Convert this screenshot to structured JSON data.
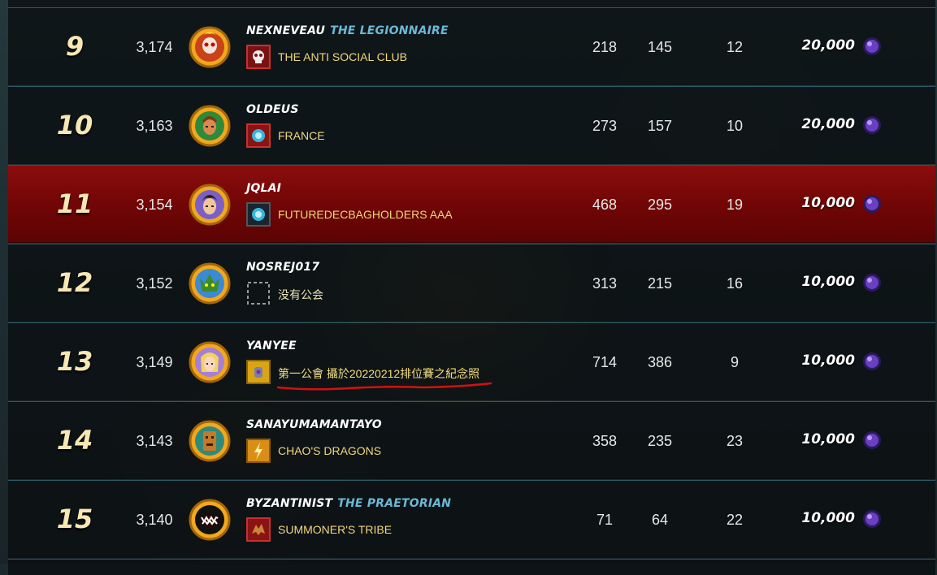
{
  "leaderboard": {
    "rows": [
      {
        "rank": "9",
        "rating": "3,174",
        "player": "NEXNEVEAU",
        "title": "THE LEGIONNAIRE",
        "guild": "THE ANTI SOCIAL CLUB",
        "stat1": "218",
        "stat2": "145",
        "stat3": "12",
        "reward": "20,000",
        "avatar_icon": "skull-flame-avatar-icon",
        "guild_icon": "skull-banner-icon"
      },
      {
        "rank": "10",
        "rating": "3,163",
        "player": "OLDEUS",
        "title": "",
        "guild": "FRANCE",
        "stat1": "273",
        "stat2": "157",
        "stat3": "10",
        "reward": "20,000",
        "avatar_icon": "warrior-avatar-icon",
        "guild_icon": "orb-banner-icon"
      },
      {
        "rank": "11",
        "rating": "3,154",
        "player": "JQLAI",
        "title": "",
        "guild": "FUTUREDECBAGHOLDERS AAA",
        "stat1": "468",
        "stat2": "295",
        "stat3": "19",
        "reward": "10,000",
        "avatar_icon": "hero-avatar-icon",
        "guild_icon": "orb-banner-icon"
      },
      {
        "rank": "12",
        "rating": "3,152",
        "player": "NOSREJ017",
        "title": "",
        "guild": "没有公会",
        "stat1": "313",
        "stat2": "215",
        "stat3": "16",
        "reward": "10,000",
        "avatar_icon": "goblin-avatar-icon",
        "guild_icon": "empty-guild-icon"
      },
      {
        "rank": "13",
        "rating": "3,149",
        "player": "YANYEE",
        "title": "",
        "guild": "第一公會 攝於20220212排位賽之紀念照",
        "stat1": "714",
        "stat2": "386",
        "stat3": "9",
        "reward": "10,000",
        "avatar_icon": "princess-avatar-icon",
        "guild_icon": "gauntlet-banner-icon"
      },
      {
        "rank": "14",
        "rating": "3,143",
        "player": "SANAYUMAMANTAYO",
        "title": "",
        "guild": "CHAO'S DRAGONS",
        "stat1": "358",
        "stat2": "235",
        "stat3": "23",
        "reward": "10,000",
        "avatar_icon": "totem-avatar-icon",
        "guild_icon": "lightning-banner-icon"
      },
      {
        "rank": "15",
        "rating": "3,140",
        "player": "BYZANTINIST",
        "title": "THE PRAETORIAN",
        "guild": "SUMMONER'S TRIBE",
        "stat1": "71",
        "stat2": "64",
        "stat3": "22",
        "reward": "10,000",
        "avatar_icon": "monster-mouth-avatar-icon",
        "guild_icon": "wolf-banner-icon"
      }
    ]
  },
  "colors": {
    "highlight_row": "#7a0808",
    "player_title": "#6ab9d6",
    "guild_name": "#f0d77c",
    "annotation_underline": "#d41010"
  },
  "icons": {
    "reward_currency": "potion-orb-icon"
  }
}
